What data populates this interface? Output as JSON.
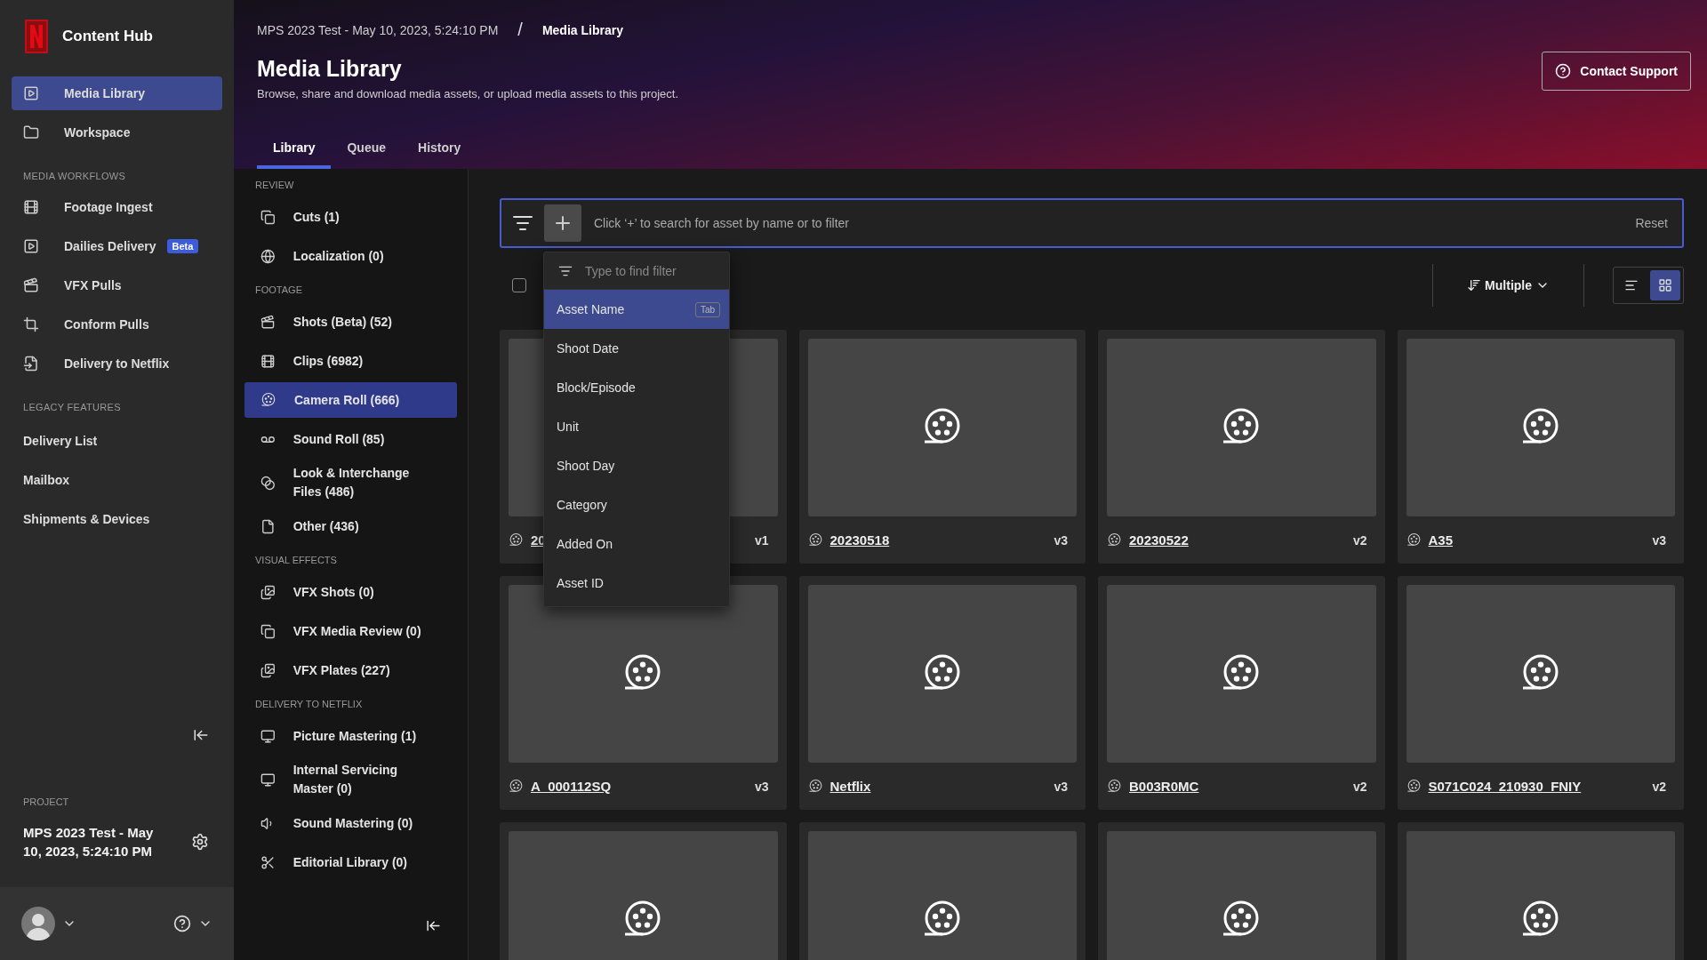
{
  "app": {
    "name": "Content Hub"
  },
  "sidebar": {
    "items": [
      {
        "label": "Media Library",
        "selected": true
      },
      {
        "label": "Workspace",
        "selected": false
      }
    ],
    "sections": [
      {
        "title": "MEDIA WORKFLOWS",
        "items": [
          {
            "label": "Footage Ingest",
            "selected": false
          },
          {
            "label": "Dailies Delivery",
            "badge": "Beta",
            "selected": false
          },
          {
            "label": "VFX Pulls",
            "selected": false
          },
          {
            "label": "Conform Pulls",
            "selected": false
          },
          {
            "label": "Delivery to Netflix",
            "selected": false
          }
        ]
      },
      {
        "title": "LEGACY FEATURES",
        "items": [
          {
            "label": "Delivery List",
            "selected": false
          },
          {
            "label": "Mailbox",
            "selected": false
          },
          {
            "label": "Shipments & Devices",
            "selected": false
          }
        ]
      }
    ],
    "project": {
      "heading": "PROJECT",
      "name": "MPS 2023 Test - May 10, 2023, 5:24:10 PM"
    }
  },
  "breadcrumbs": [
    "MPS 2023 Test - May 10, 2023, 5:24:10 PM",
    "Media Library"
  ],
  "breadcrumb_separator": "/",
  "page": {
    "title": "Media Library",
    "subtitle": "Browse, share and download media assets, or upload media assets to this project.",
    "support_button": "Contact Support"
  },
  "tabs": [
    {
      "label": "Library",
      "selected": true
    },
    {
      "label": "Queue",
      "selected": false
    },
    {
      "label": "History",
      "selected": false
    }
  ],
  "categories": [
    {
      "title": "REVIEW",
      "items": [
        {
          "label": "Cuts (1)",
          "selected": false
        },
        {
          "label": "Localization (0)",
          "selected": false
        }
      ]
    },
    {
      "title": "FOOTAGE",
      "items": [
        {
          "label": "Shots (Beta) (52)",
          "selected": false
        },
        {
          "label": "Clips (6982)",
          "selected": false
        },
        {
          "label": "Camera Roll (666)",
          "selected": true
        },
        {
          "label": "Sound Roll (85)",
          "selected": false
        },
        {
          "label": "Look & Interchange Files (486)",
          "selected": false
        },
        {
          "label": "Other (436)",
          "selected": false
        }
      ]
    },
    {
      "title": "VISUAL EFFECTS",
      "items": [
        {
          "label": "VFX Shots (0)",
          "selected": false
        },
        {
          "label": "VFX Media Review (0)",
          "selected": false
        },
        {
          "label": "VFX Plates (227)",
          "selected": false
        }
      ]
    },
    {
      "title": "DELIVERY TO NETFLIX",
      "items": [
        {
          "label": "Picture Mastering (1)",
          "selected": false
        },
        {
          "label": "Internal Servicing Master (0)",
          "selected": false
        },
        {
          "label": "Sound Mastering (0)",
          "selected": false
        },
        {
          "label": "Editorial Library (0)",
          "selected": false
        }
      ]
    }
  ],
  "search": {
    "placeholder": "Click ‘+’ to search for asset by name or to filter",
    "reset": "Reset"
  },
  "filter_menu": {
    "placeholder": "Type to find filter",
    "items": [
      {
        "label": "Asset Name",
        "shortcut": "Tab",
        "selected": true
      },
      {
        "label": "Shoot Date",
        "selected": false
      },
      {
        "label": "Block/Episode",
        "selected": false
      },
      {
        "label": "Unit",
        "selected": false
      },
      {
        "label": "Shoot Day",
        "selected": false
      },
      {
        "label": "Category",
        "selected": false
      },
      {
        "label": "Added On",
        "selected": false
      },
      {
        "label": "Asset ID",
        "selected": false
      }
    ]
  },
  "toolbar": {
    "select_all_checked": false,
    "sort": "Multiple",
    "views": [
      {
        "kind": "list",
        "selected": false
      },
      {
        "kind": "grid",
        "selected": true
      }
    ]
  },
  "assets": [
    {
      "kind": "partly-covered-card",
      "name": "20",
      "version": "v1"
    },
    {
      "kind": "card",
      "name": "20230518",
      "version": "v3"
    },
    {
      "kind": "card",
      "name": "20230522",
      "version": "v2"
    },
    {
      "kind": "card",
      "name": "A35",
      "version": "v3"
    },
    {
      "kind": "card",
      "name": "A_000112SQ",
      "version": "v3"
    },
    {
      "kind": "card",
      "name": "Netflix",
      "version": "v3"
    },
    {
      "kind": "card",
      "name": "B003R0MC",
      "version": "v2"
    },
    {
      "kind": "card",
      "name": "S071C024_210930_FNIY",
      "version": "v2"
    },
    {
      "kind": "thumbnail"
    },
    {
      "kind": "thumbnail"
    },
    {
      "kind": "thumbnail"
    },
    {
      "kind": "thumbnail"
    }
  ]
}
